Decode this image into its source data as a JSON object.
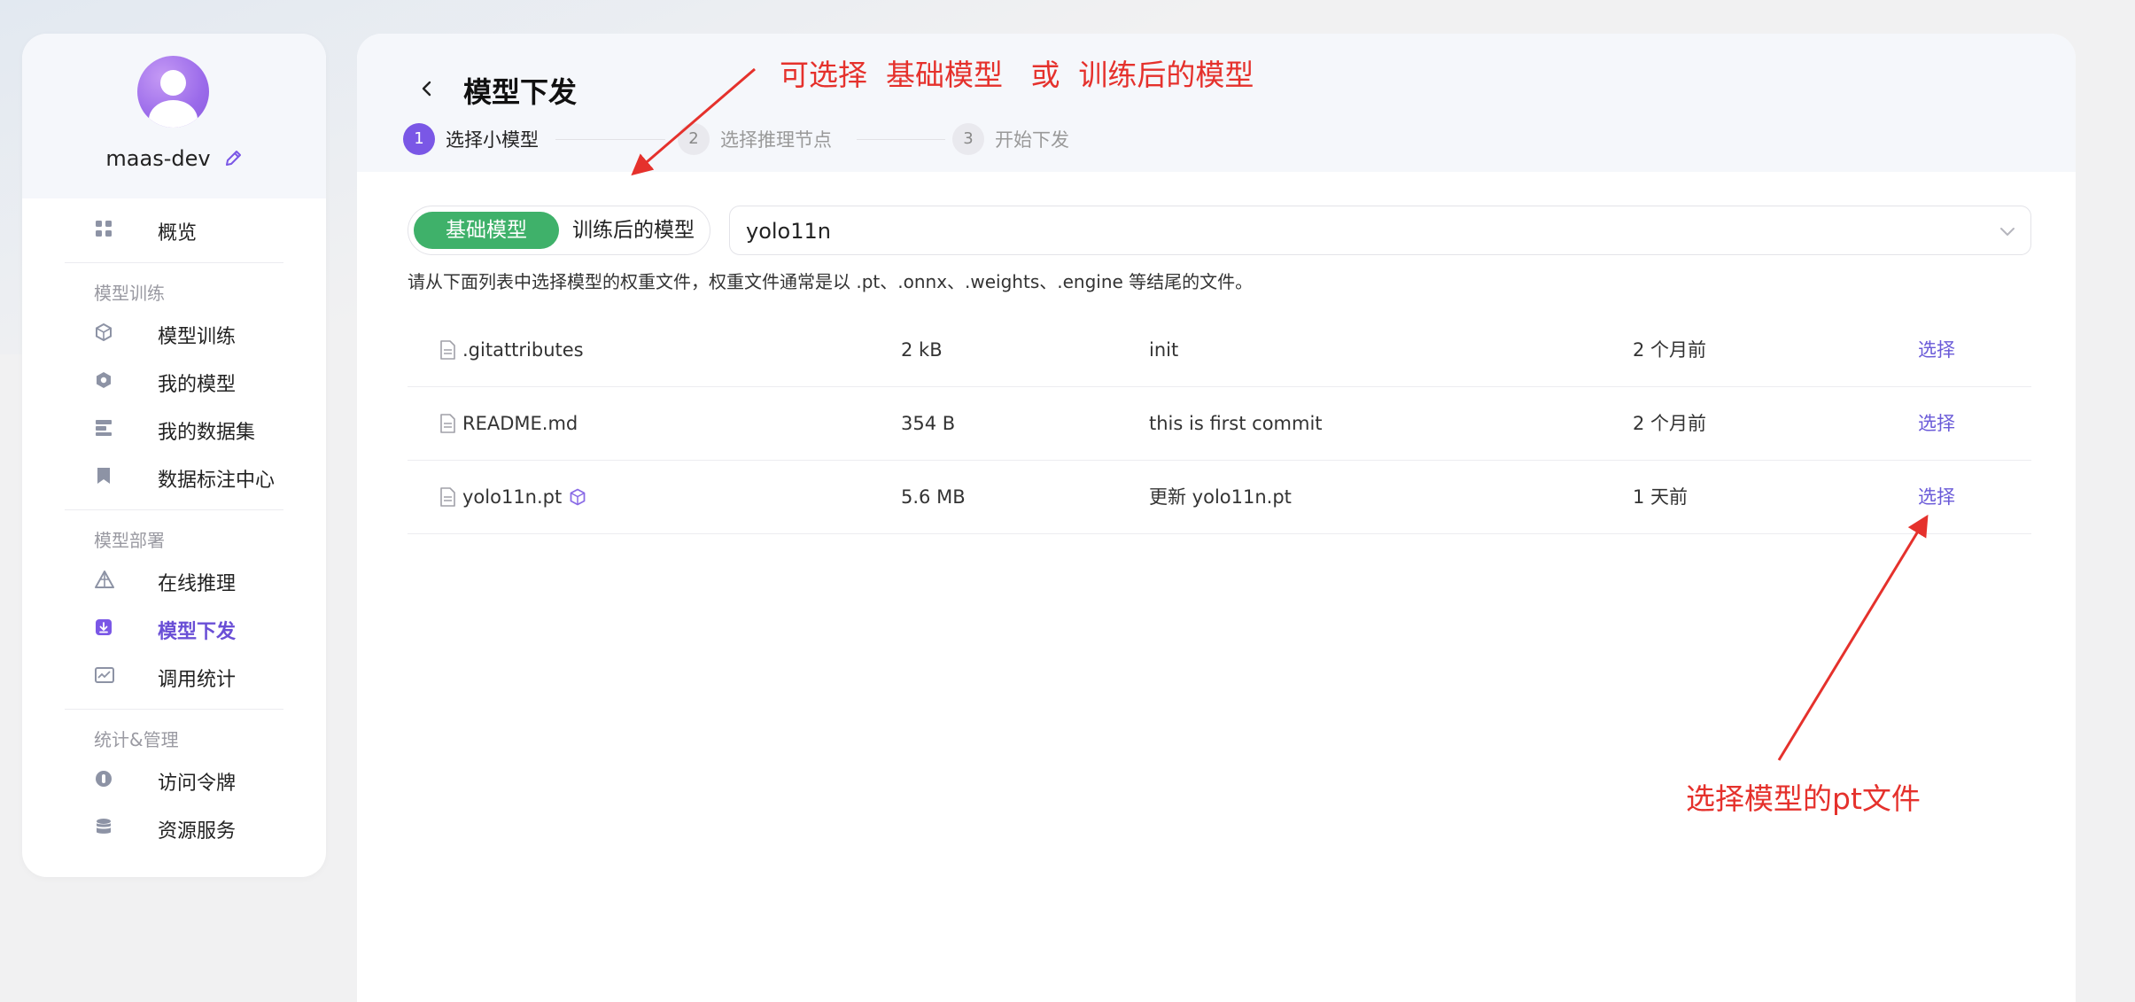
{
  "sidebar": {
    "username": "maas-dev",
    "overview": "概览",
    "groups": [
      {
        "title": "模型训练",
        "items": [
          {
            "label": "模型训练",
            "icon": "box-icon"
          },
          {
            "label": "我的模型",
            "icon": "cube-icon"
          },
          {
            "label": "我的数据集",
            "icon": "dataset-icon"
          },
          {
            "label": "数据标注中心",
            "icon": "bookmark-icon"
          }
        ]
      },
      {
        "title": "模型部署",
        "items": [
          {
            "label": "在线推理",
            "icon": "pyramid-icon"
          },
          {
            "label": "模型下发",
            "icon": "download-icon",
            "active": true
          },
          {
            "label": "调用统计",
            "icon": "chart-icon"
          }
        ]
      },
      {
        "title": "统计&管理",
        "items": [
          {
            "label": "访问令牌",
            "icon": "token-icon"
          },
          {
            "label": "资源服务",
            "icon": "database-icon"
          }
        ]
      }
    ]
  },
  "page": {
    "title": "模型下发",
    "steps": [
      {
        "num": "1",
        "label": "选择小模型"
      },
      {
        "num": "2",
        "label": "选择推理节点"
      },
      {
        "num": "3",
        "label": "开始下发"
      }
    ],
    "segment": {
      "base": "基础模型",
      "trained": "训练后的模型"
    },
    "select_value": "yolo11n",
    "hint": "请从下面列表中选择模型的权重文件，权重文件通常是以 .pt、.onnx、.weights、.engine 等结尾的文件。",
    "files": [
      {
        "name": ".gitattributes",
        "size": "2 kB",
        "message": "init",
        "time": "2 个月前",
        "action": "选择"
      },
      {
        "name": "README.md",
        "size": "354 B",
        "message": "this is first commit",
        "time": "2 个月前",
        "action": "选择"
      },
      {
        "name": "yolo11n.pt",
        "size": "5.6 MB",
        "message": "更新 yolo11n.pt",
        "time": "1 天前",
        "action": "选择"
      }
    ]
  },
  "annotations": {
    "top": "可选择  基础模型   或  训练后的模型",
    "bottom": "选择模型的pt文件"
  },
  "colors": {
    "accent": "#7a57e6",
    "green": "#3fb16a",
    "link": "#6a5ad8",
    "annotation": "#e5312c"
  }
}
